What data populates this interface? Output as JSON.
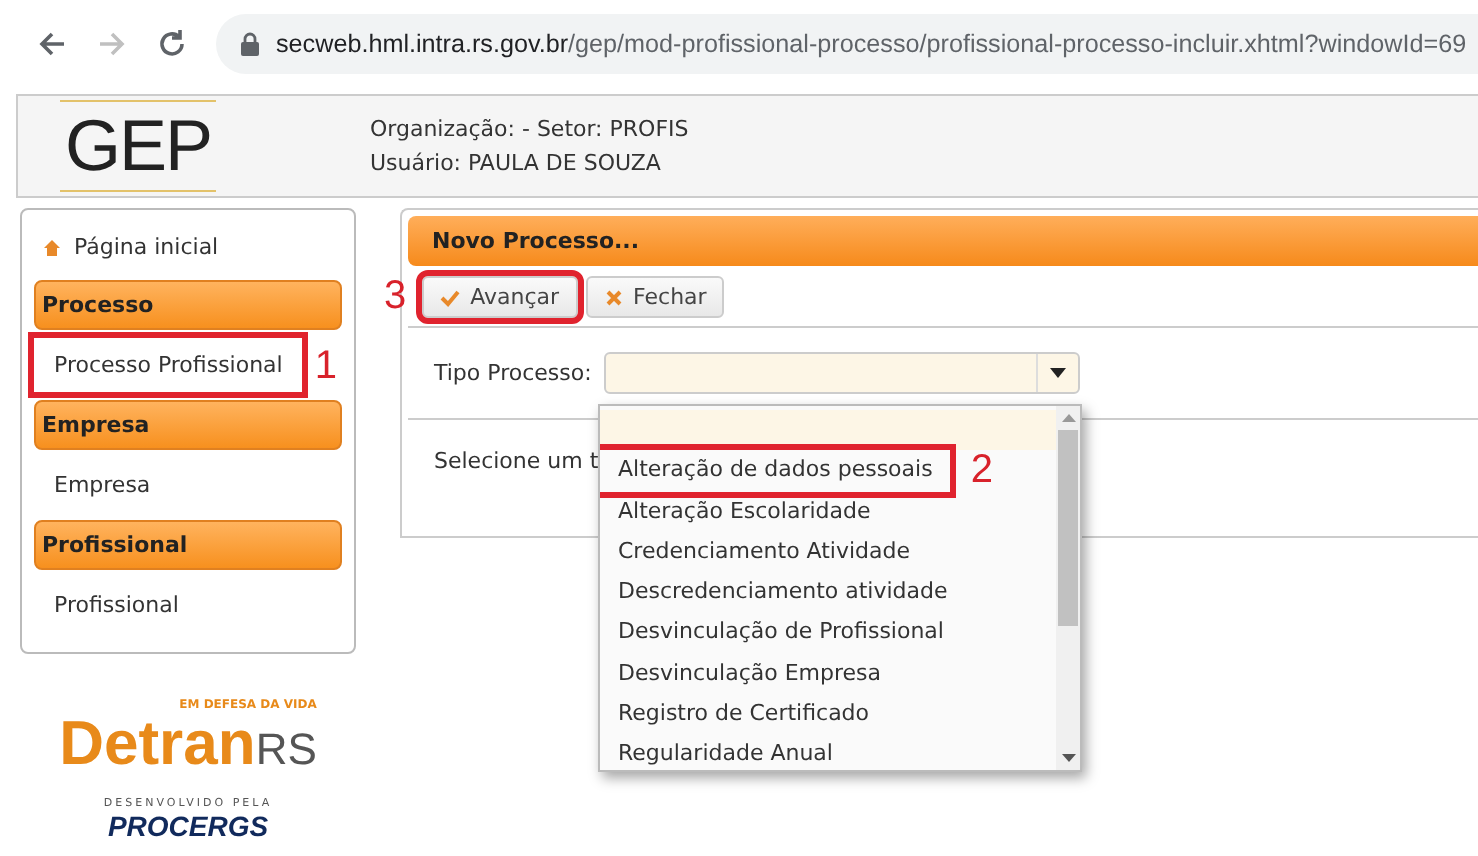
{
  "browser": {
    "back_enabled": true,
    "forward_enabled": false,
    "url_host": "secweb.hml.intra.rs.gov.br",
    "url_path": "/gep/mod-profissional-processo/profissional-processo-incluir.xhtml?windowId=69"
  },
  "header": {
    "logo": "GEP",
    "lines": [
      "Organização: - Setor: PROFIS",
      "Usuário: PAULA DE SOUZA"
    ]
  },
  "sidebar": {
    "home": "Página inicial",
    "groups": [
      {
        "title": "Processo",
        "items": [
          {
            "label": "Processo Profissional",
            "callout": "1"
          }
        ]
      },
      {
        "title": "Empresa",
        "items": [
          {
            "label": "Empresa"
          }
        ]
      },
      {
        "title": "Profissional",
        "items": [
          {
            "label": "Profissional"
          }
        ]
      }
    ]
  },
  "logos": {
    "detran_tagline": "EM DEFESA DA VIDA",
    "detran_main": "Detran",
    "detran_suffix": "RS",
    "procergs_caption": "DESENVOLVIDO PELA",
    "procergs_name": "PROCERGS"
  },
  "panel": {
    "title": "Novo Processo...",
    "buttons": [
      {
        "label": "Avançar",
        "kind": "confirm",
        "callout": "3"
      },
      {
        "label": "Fechar",
        "kind": "close"
      }
    ],
    "field_label": "Tipo Processo:",
    "hint": "Selecione um t",
    "dropdown": {
      "options": [
        {
          "selected": true
        },
        {
          "label": "Alteração de dados pessoais",
          "selected": false,
          "callout": "2"
        },
        {
          "label": "Alteração Escolaridade",
          "selected": false
        },
        {
          "label": "Credenciamento Atividade",
          "selected": false
        },
        {
          "label": "Descredenciamento atividade",
          "selected": false
        },
        {
          "label": "Desvinculação de Profissional",
          "selected": false
        },
        {
          "label": "Desvinculação Empresa",
          "selected": false
        },
        {
          "label": "Registro de Certificado",
          "selected": false
        },
        {
          "label": "Regularidade Anual",
          "selected": false
        }
      ]
    }
  }
}
